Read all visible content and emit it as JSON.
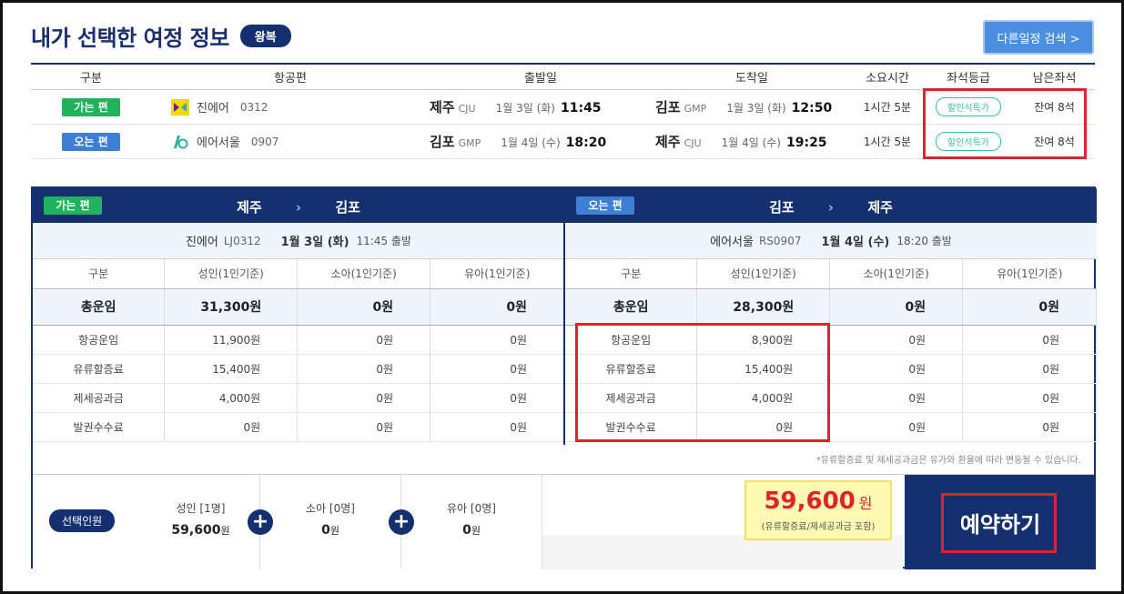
{
  "header": {
    "title": "내가 선택한 여정 정보",
    "trip_type": "왕복",
    "search_button": "다른일정 검색 >"
  },
  "itinerary": {
    "columns": [
      "구분",
      "항공편",
      "출발일",
      "도착일",
      "소요시간",
      "좌석등급",
      "남은좌석"
    ],
    "rows": [
      {
        "direction": "가는 편",
        "airline": "진에어",
        "flight_no": "0312",
        "dep_city": "제주",
        "dep_code": "CJU",
        "dep_date": "1월 3일 (화)",
        "dep_time": "11:45",
        "arr_city": "김포",
        "arr_code": "GMP",
        "arr_date": "1월 3일 (화)",
        "arr_time": "12:50",
        "duration": "1시간  5분",
        "seat_class": "할인석특가",
        "remaining": "잔여 8석"
      },
      {
        "direction": "오는 편",
        "airline": "에어서울",
        "flight_no": "0907",
        "dep_city": "김포",
        "dep_code": "GMP",
        "dep_date": "1월 4일 (수)",
        "dep_time": "18:20",
        "arr_city": "제주",
        "arr_code": "CJU",
        "arr_date": "1월 4일 (수)",
        "arr_time": "19:25",
        "duration": "1시간  5분",
        "seat_class": "할인석특가",
        "remaining": "잔여 8석"
      }
    ]
  },
  "fares": [
    {
      "direction": "가는 편",
      "from": "제주",
      "to": "김포",
      "airline": "진에어",
      "flight_no": "LJ0312",
      "date": "1월 3일 (화)",
      "time": "11:45 출발",
      "columns": [
        "구분",
        "성인(1인기준)",
        "소아(1인기준)",
        "유아(1인기준)"
      ],
      "total": {
        "label": "총운임",
        "adult": "31,300원",
        "child": "0원",
        "infant": "0원"
      },
      "items": [
        {
          "label": "항공운임",
          "adult": "11,900원",
          "child": "0원",
          "infant": "0원"
        },
        {
          "label": "유류할증료",
          "adult": "15,400원",
          "child": "0원",
          "infant": "0원"
        },
        {
          "label": "제세공과금",
          "adult": "4,000원",
          "child": "0원",
          "infant": "0원"
        },
        {
          "label": "발권수수료",
          "adult": "0원",
          "child": "0원",
          "infant": "0원"
        }
      ]
    },
    {
      "direction": "오는 편",
      "from": "김포",
      "to": "제주",
      "airline": "에어서울",
      "flight_no": "RS0907",
      "date": "1월 4일 (수)",
      "time": "18:20 출발",
      "columns": [
        "구분",
        "성인(1인기준)",
        "소아(1인기준)",
        "유아(1인기준)"
      ],
      "total": {
        "label": "총운임",
        "adult": "28,300원",
        "child": "0원",
        "infant": "0원"
      },
      "items": [
        {
          "label": "항공운임",
          "adult": "8,900원",
          "child": "0원",
          "infant": "0원"
        },
        {
          "label": "유류할증료",
          "adult": "15,400원",
          "child": "0원",
          "infant": "0원"
        },
        {
          "label": "제세공과금",
          "adult": "4,000원",
          "child": "0원",
          "infant": "0원"
        },
        {
          "label": "발권수수료",
          "adult": "0원",
          "child": "0원",
          "infant": "0원"
        }
      ]
    }
  ],
  "notice": "*유류할증료 및 제세공과금은 유가와 환율에 따라 변동될 수 있습니다.",
  "summary": {
    "badge": "선택인원",
    "adult": {
      "title": "성인 [1명]",
      "amount": "59,600",
      "unit": "원"
    },
    "child": {
      "title": "소아 [0명]",
      "amount": "0",
      "unit": "원"
    },
    "infant": {
      "title": "유아 [0명]",
      "amount": "0",
      "unit": "원"
    },
    "total_amount": "59,600",
    "total_unit": "원",
    "total_note": "(유류할증료/제세공과금 포함)",
    "reserve_button": "예약하기"
  },
  "colors": {
    "navy": "#14306e",
    "go_badge": "#1fb35b",
    "return_badge": "#3d7fd6",
    "highlight_red": "#e0232a",
    "total_box": "#fffbb3"
  }
}
